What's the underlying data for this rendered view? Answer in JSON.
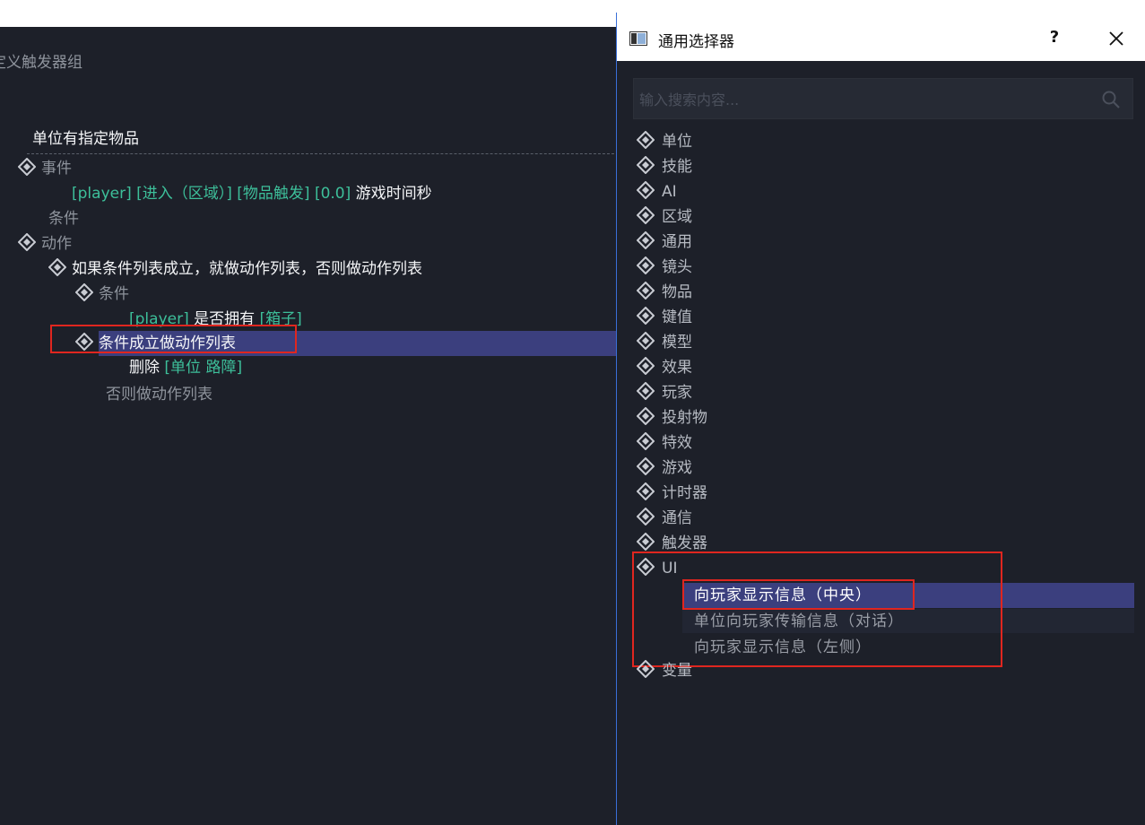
{
  "editor": {
    "group_title": "定义触发器组",
    "trigger_name": "单位有指定物品",
    "events_label": "事件",
    "event_line": "[player] [进入（区域）] [物品触发] [0.0]",
    "event_suffix": "游戏时间秒",
    "conditions_label": "条件",
    "actions_label": "动作",
    "if_action": "如果条件列表成立，就做动作列表，否则做动作列表",
    "if_conditions_label": "条件",
    "cond_player": "[player]",
    "cond_text": "是否拥有",
    "cond_item": "[箱子]",
    "then_label": "条件成立做动作列表",
    "delete_text": "删除",
    "delete_target": "[单位 路障]",
    "else_label": "否则做动作列表"
  },
  "dialog": {
    "title": "通用选择器",
    "help_label": "?",
    "search_placeholder": "输入搜索内容...",
    "categories": [
      "单位",
      "技能",
      "AI",
      "区域",
      "通用",
      "镜头",
      "物品",
      "键值",
      "模型",
      "效果",
      "玩家",
      "投射物",
      "特效",
      "游戏",
      "计时器",
      "通信",
      "触发器",
      "UI",
      "变量"
    ],
    "ui_children": [
      "向玩家显示信息（中央）",
      "单位向玩家传输信息（对话）",
      "向玩家显示信息（左侧）"
    ]
  },
  "colors": {
    "background": "#1d2029",
    "selection": "#3b3f7e",
    "highlight_green": "#3dbf9a",
    "annotation_red": "#e0261f"
  }
}
